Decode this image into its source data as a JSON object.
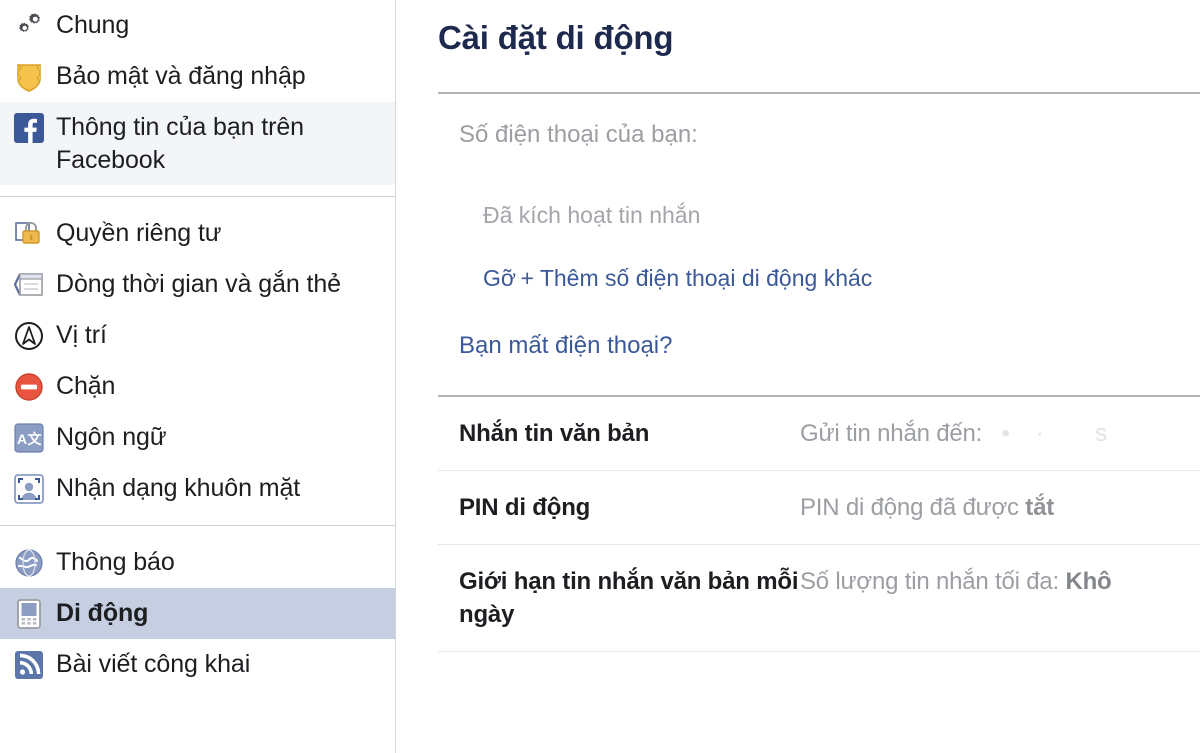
{
  "sidebar": {
    "groups": [
      {
        "items": [
          {
            "label": "Chung",
            "icon": "gears-icon",
            "state": "default"
          },
          {
            "label": "Bảo mật và đăng nhập",
            "icon": "shield-badge-icon",
            "state": "default"
          },
          {
            "label": "Thông tin của bạn trên Facebook",
            "icon": "facebook-logo-icon",
            "state": "tinted"
          }
        ]
      },
      {
        "items": [
          {
            "label": "Quyền riêng tư",
            "icon": "padlock-icon",
            "state": "default"
          },
          {
            "label": "Dòng thời gian và gắn thẻ",
            "icon": "timeline-tag-icon",
            "state": "default"
          },
          {
            "label": "Vị trí",
            "icon": "location-compass-icon",
            "state": "default"
          },
          {
            "label": "Chặn",
            "icon": "block-icon",
            "state": "default"
          },
          {
            "label": "Ngôn ngữ",
            "icon": "language-translate-icon",
            "state": "default"
          },
          {
            "label": "Nhận dạng khuôn mặt",
            "icon": "face-recognition-icon",
            "state": "default"
          }
        ]
      },
      {
        "items": [
          {
            "label": "Thông báo",
            "icon": "globe-notification-icon",
            "state": "default"
          },
          {
            "label": "Di động",
            "icon": "mobile-phone-icon",
            "state": "selected"
          },
          {
            "label": "Bài viết công khai",
            "icon": "rss-feed-icon",
            "state": "default"
          }
        ]
      }
    ]
  },
  "main": {
    "page_title": "Cài đặt di động",
    "phone": {
      "your_phone_label": "Số điện thoại của bạn:",
      "status": "Đã kích hoạt tin nhắn",
      "remove_link": "Gỡ",
      "add_another_link": "+ Thêm số điện thoại di động khác",
      "lost_phone_link": "Bạn mất điện thoại?"
    },
    "settings_rows": [
      {
        "label": "Nhắn tin văn bản",
        "value_prefix": "Gửi tin nhắn đến:",
        "value_masked": "",
        "value_suffix": ""
      },
      {
        "label": "PIN di động",
        "value_prefix": "PIN di động đã được",
        "value_bold": "tắt",
        "value_suffix": ""
      },
      {
        "label": "Giới hạn tin nhắn văn bản mỗi ngày",
        "value_prefix": "Số lượng tin nhắn tối đa:",
        "value_bold": "Khô",
        "value_suffix": ""
      }
    ]
  },
  "colors": {
    "title_navy": "#1d2a4d",
    "link_blue": "#3b5998",
    "selected_row": "#c6cfe2",
    "tinted_row": "#f4f5f7",
    "muted_text": "#9b9ea3",
    "divider": "#e9e9eb",
    "rule_strong": "#b3b3b3"
  }
}
